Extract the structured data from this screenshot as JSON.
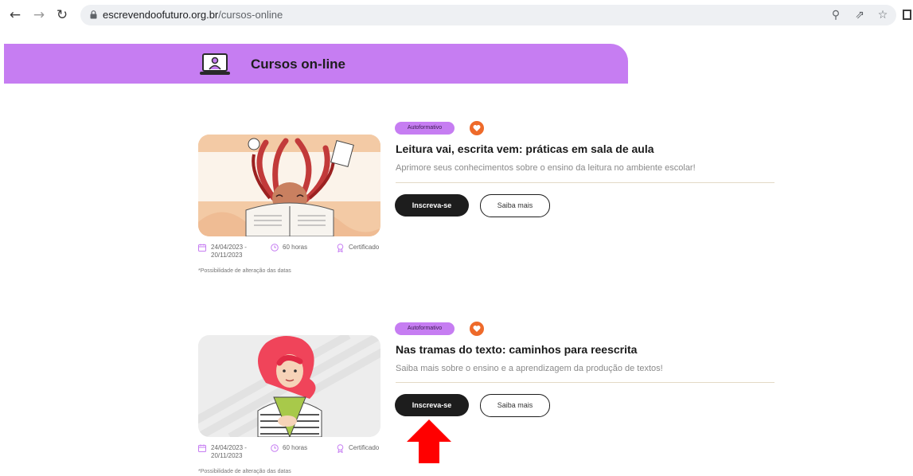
{
  "browser": {
    "url_domain": "escrevendoofuturo.org.br",
    "url_path": "/cursos-online",
    "back_icon": "arrow-left-icon",
    "forward_icon": "arrow-right-icon",
    "reload_icon": "reload-icon",
    "zoom_icon": "zoom-icon",
    "share_icon": "share-icon",
    "bookmark_icon": "star-icon"
  },
  "header": {
    "title": "Cursos on-line",
    "icon": "laptop-user-icon",
    "color": "#c67df2"
  },
  "courses": [
    {
      "badge": "Autoformativo",
      "title": "Leitura vai, escrita vem: práticas em sala de aula",
      "description": "Aprimore seus conhecimentos sobre o ensino da leitura no ambiente escolar!",
      "date_start": "24/04/2023 -",
      "date_end": "20/11/2023",
      "hours": "60 horas",
      "certificate": "Certificado",
      "note": "*Possibilidade de alteração das datas",
      "enroll_label": "Inscreva-se",
      "more_label": "Saiba mais"
    },
    {
      "badge": "Autoformativo",
      "title": "Nas tramas do texto: caminhos para reescrita",
      "description": "Saiba mais sobre o ensino e a aprendizagem da produção de textos!",
      "date_start": "24/04/2023 -",
      "date_end": "20/11/2023",
      "hours": "60 horas",
      "certificate": "Certificado",
      "note": "*Possibilidade de alteração das datas",
      "enroll_label": "Inscreva-se",
      "more_label": "Saiba mais"
    }
  ],
  "colors": {
    "accent": "#c67df2",
    "favorite": "#ee6a2a",
    "button_dark": "#1d1d1d",
    "annotation_arrow": "#ff0000"
  }
}
